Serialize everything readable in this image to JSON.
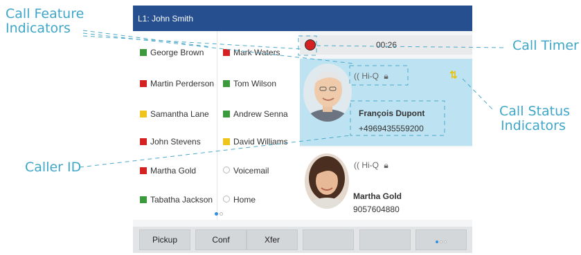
{
  "callouts": {
    "call_feature_line1": "Call Feature",
    "call_feature_line2": "Indicators",
    "caller_id": "Caller ID",
    "call_timer": "Call Timer",
    "call_status_line1": "Call Status",
    "call_status_line2": "Indicators"
  },
  "phone": {
    "line_title": "L1: John Smith",
    "contacts_left": [
      {
        "name": "George Brown",
        "status_color": "#3a9a3c"
      },
      {
        "name": "Martin Perderson",
        "status_color": "#d52121"
      },
      {
        "name": "Samantha Lane",
        "status_color": "#f0c51b"
      },
      {
        "name": "John Stevens",
        "status_color": "#d52121"
      },
      {
        "name": "Martha Gold",
        "status_color": "#d52121"
      },
      {
        "name": "Tabatha Jackson",
        "status_color": "#3a9a3c"
      }
    ],
    "contacts_right": [
      {
        "name": "Mark Waters",
        "status_color": "#d52121"
      },
      {
        "name": "Tom Wilson",
        "status_color": "#3a9a3c"
      },
      {
        "name": "Andrew Senna",
        "status_color": "#3a9a3c"
      },
      {
        "name": "David Williams",
        "status_color": "#f0c51b"
      },
      {
        "name": "Voicemail",
        "status_color": "none"
      },
      {
        "name": "Home",
        "status_color": "none"
      }
    ],
    "timer": "00:26",
    "hiq_label": "Hi-Q",
    "active_call": {
      "name": "François Dupont",
      "number": "+4969435559200"
    },
    "held_call": {
      "name": "Martha Gold",
      "number": "9057604880"
    },
    "softkeys": [
      "Pickup",
      "Conf",
      "Xfer",
      "",
      ""
    ],
    "accent_color": "#264f8f",
    "highlight_color": "#bde3f2",
    "recording_color": "#d52121"
  }
}
